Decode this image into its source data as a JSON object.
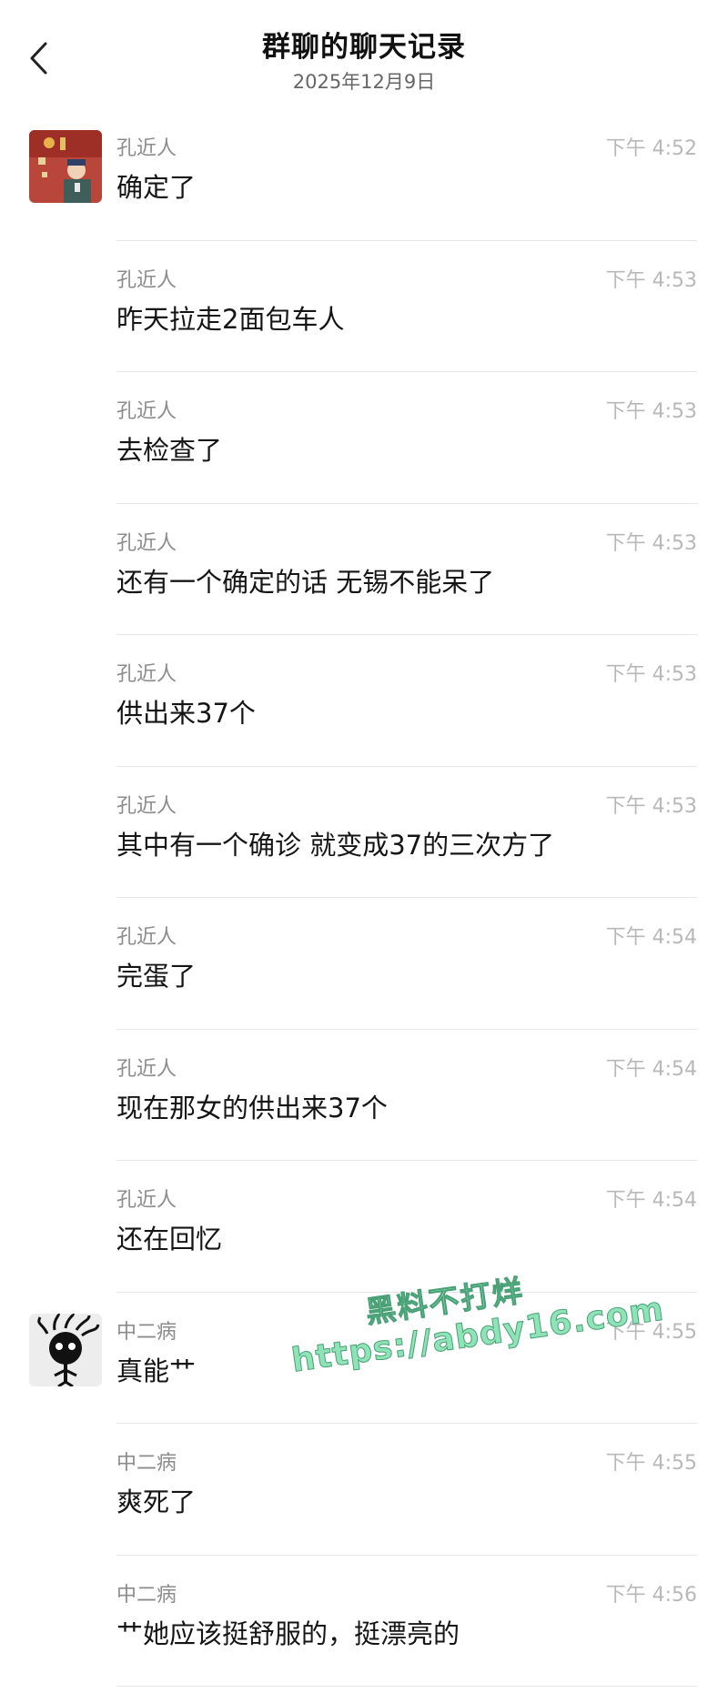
{
  "header": {
    "title": "群聊的聊天记录",
    "date": "2025年12月9日",
    "back_icon": "chevron-left-icon"
  },
  "messages": [
    {
      "sender": "孔近人",
      "time": "下午 4:52",
      "text": "确定了",
      "avatar": "kong-avatar"
    },
    {
      "sender": "孔近人",
      "time": "下午 4:53",
      "text": "昨天拉走2面包车人"
    },
    {
      "sender": "孔近人",
      "time": "下午 4:53",
      "text": "去检查了"
    },
    {
      "sender": "孔近人",
      "time": "下午 4:53",
      "text": "还有一个确定的话 无锡不能呆了"
    },
    {
      "sender": "孔近人",
      "time": "下午 4:53",
      "text": "供出来37个"
    },
    {
      "sender": "孔近人",
      "time": "下午 4:53",
      "text": "其中有一个确诊 就变成37的三次方了"
    },
    {
      "sender": "孔近人",
      "time": "下午 4:54",
      "text": "完蛋了"
    },
    {
      "sender": "孔近人",
      "time": "下午 4:54",
      "text": "现在那女的供出来37个"
    },
    {
      "sender": "孔近人",
      "time": "下午 4:54",
      "text": "还在回忆"
    },
    {
      "sender": "中二病",
      "time": "下午 4:55",
      "text": "真能艹",
      "avatar": "zhongerbing-avatar"
    },
    {
      "sender": "中二病",
      "time": "下午 4:55",
      "text": "爽死了"
    },
    {
      "sender": "中二病",
      "time": "下午 4:56",
      "text": "艹她应该挺舒服的，挺漂亮的"
    }
  ],
  "watermark": {
    "line1": "黑料不打烊",
    "line2": "https://abdy16.com"
  },
  "colors": {
    "background": "#ffffff",
    "sender_text": "#8c8c8c",
    "time_text": "#b8b8b8",
    "divider": "#e6e6e6",
    "watermark": "#8ee3b7"
  }
}
